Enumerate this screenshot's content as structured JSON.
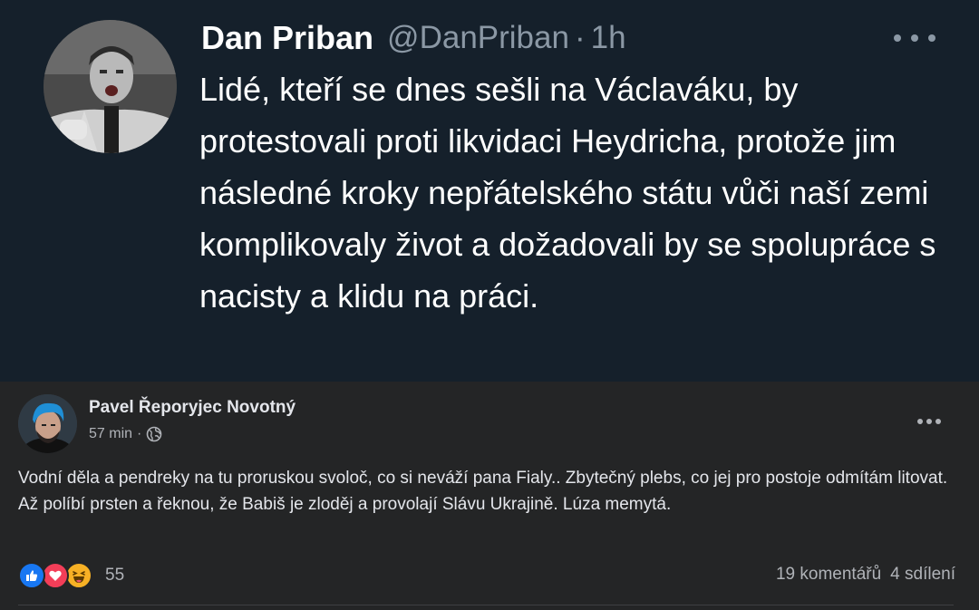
{
  "tweet": {
    "author_name": "Dan Priban",
    "handle": "@DanPriban",
    "separator": "·",
    "time": "1h",
    "avatar_icon": "profile-photo",
    "more_icon": "more-horizontal-icon",
    "text": "Lidé, kteří se dnes sešli na Václaváku, by protestovali proti likvidaci Heydricha, protože jim následné kroky nepřátelského státu vůči naší zemi komplikovaly život a dožadovali by se spolupráce s nacisty a klidu na práci.",
    "colors": {
      "background": "#15202b",
      "text": "#ffffff",
      "muted": "#8b98a5"
    }
  },
  "post": {
    "author_name": "Pavel Řeporyjec Novotný",
    "time": "57 min",
    "separator": "·",
    "privacy_icon": "globe-icon",
    "more_icon": "more-horizontal-icon",
    "text": "Vodní děla a pendreky na tu proruskou svoloč, co si neváží pana Fialy.. Zbytečný plebs, co jej pro postoje odmítám litovat. Až políbí prsten a řeknou, že Babiš je zloděj a provolají Slávu Ukrajině. Lúza memytá.",
    "reactions": {
      "icons": [
        "like-reaction-icon",
        "love-reaction-icon",
        "haha-reaction-icon"
      ],
      "count": "55"
    },
    "comments": "19 komentářů",
    "shares": "4 sdílení",
    "colors": {
      "background": "#242526",
      "text": "#e4e6eb",
      "muted": "#b0b3b8",
      "like": "#1877f2",
      "love": "#f33e58",
      "haha": "#f7b125"
    }
  }
}
